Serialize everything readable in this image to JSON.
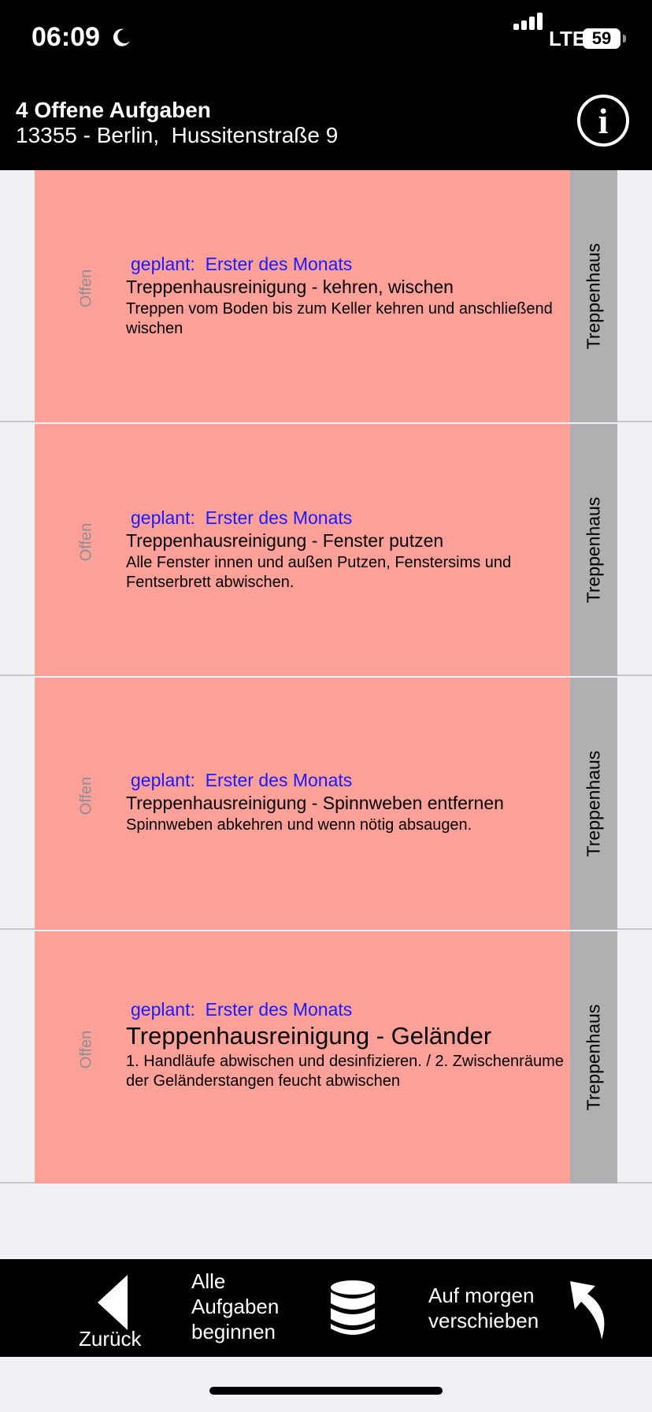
{
  "status_bar": {
    "time": "06:09",
    "network": "LTE",
    "battery": "59"
  },
  "header": {
    "title": "4 Offene Aufgaben",
    "address": "13355 - Berlin,  Hussitenstraße 9",
    "info_icon": "i"
  },
  "tasks": [
    {
      "status": "Offen",
      "plan": "geplant:  Erster des Monats",
      "title": "Treppenhausreinigung - kehren, wischen",
      "description": "Treppen vom Boden bis zum Keller kehren und anschließend wischen",
      "category": "Treppenhaus"
    },
    {
      "status": "Offen",
      "plan": "geplant:  Erster des Monats",
      "title": "Treppenhausreinigung - Fenster putzen",
      "description": "Alle Fenster innen und außen Putzen, Fenstersims und Fentserbrett abwischen.",
      "category": "Treppenhaus"
    },
    {
      "status": "Offen",
      "plan": "geplant:  Erster des Monats",
      "title": "Treppenhausreinigung - Spinnweben entfernen",
      "description": "Spinnweben abkehren und wenn nötig absaugen.",
      "category": "Treppenhaus"
    },
    {
      "status": "Offen",
      "plan": "geplant:  Erster des Monats",
      "title": "Treppenhausreinigung - Geländer",
      "description": "1. Handläufe abwischen und desinfizieren. / 2. Zwischenräume der Geländerstangen feucht abwischen",
      "category": "Treppenhaus"
    }
  ],
  "toolbar": {
    "back_label": "Zurück",
    "start_all_label": "Alle Aufgaben beginnen",
    "database_icon": "database-icon",
    "postpone_label": "Auf morgen verschieben",
    "postpone_icon": "curved-arrow-icon"
  },
  "colors": {
    "task_card": "#ffa198",
    "category_strip": "#b0b0b2",
    "plan_text": "#1a1aff",
    "bars": "#000000"
  }
}
